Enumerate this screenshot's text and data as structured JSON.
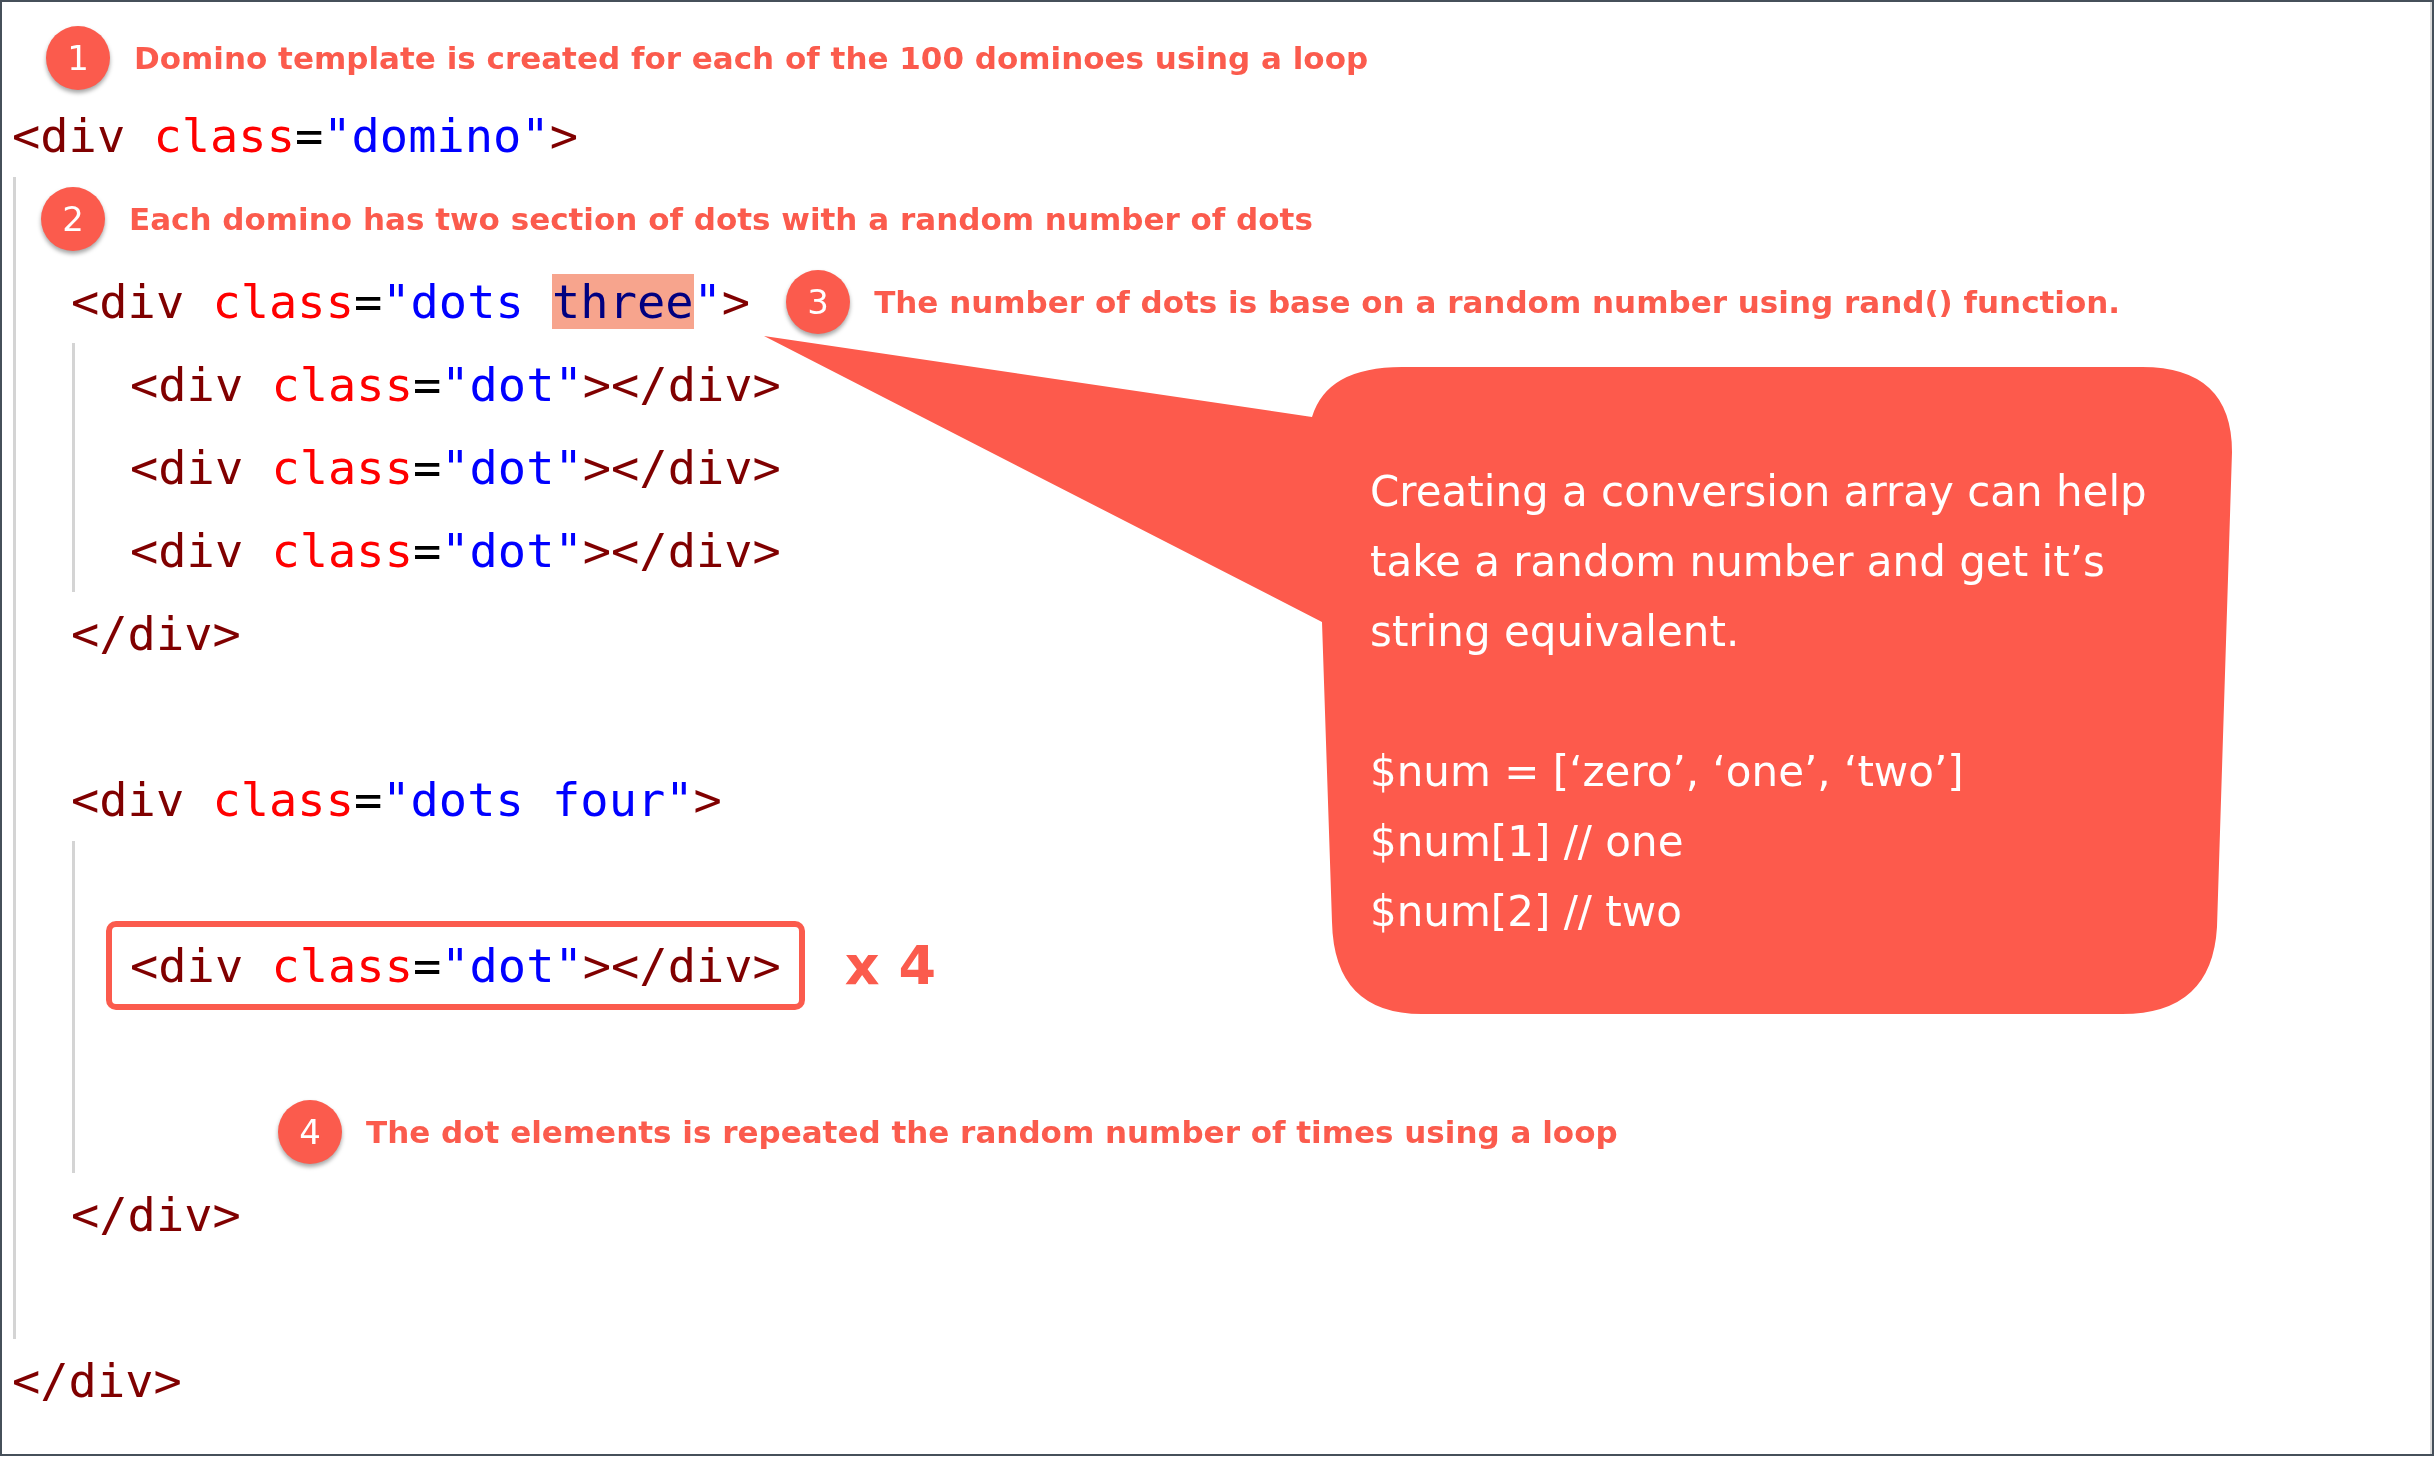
{
  "top_annotation": {
    "number": "1",
    "text": "Domino template is created for each of the 100 dominoes using a loop"
  },
  "code": {
    "kind": "element",
    "open": [
      {
        "kind": "tag",
        "t": "<div"
      },
      {
        "kind": "attr",
        "t": " class"
      },
      {
        "kind": "op",
        "t": "="
      },
      {
        "kind": "str",
        "t": "\"domino\""
      },
      {
        "kind": "tag",
        "t": ">"
      }
    ],
    "children": [
      {
        "kind": "annotation",
        "number": "2",
        "text": "Each domino has two section of dots with a random number of dots"
      },
      {
        "kind": "element",
        "open": [
          {
            "kind": "tag",
            "t": "<div"
          },
          {
            "kind": "attr",
            "t": " class"
          },
          {
            "kind": "op",
            "t": "="
          },
          {
            "kind": "str",
            "t": "\"dots "
          },
          {
            "kind": "hl",
            "t": "three"
          },
          {
            "kind": "str",
            "t": "\""
          },
          {
            "kind": "tag",
            "t": ">"
          }
        ],
        "annotation": {
          "number": "3",
          "text": "The number of dots is base on a random number using rand() function."
        },
        "children": [
          {
            "kind": "line",
            "tokens": [
              {
                "kind": "tag",
                "t": "<div"
              },
              {
                "kind": "attr",
                "t": " class"
              },
              {
                "kind": "op",
                "t": "="
              },
              {
                "kind": "str",
                "t": "\"dot\""
              },
              {
                "kind": "tag",
                "t": "></div>"
              }
            ]
          },
          {
            "kind": "line",
            "tokens": [
              {
                "kind": "tag",
                "t": "<div"
              },
              {
                "kind": "attr",
                "t": " class"
              },
              {
                "kind": "op",
                "t": "="
              },
              {
                "kind": "str",
                "t": "\"dot\""
              },
              {
                "kind": "tag",
                "t": "></div>"
              }
            ]
          },
          {
            "kind": "line",
            "tokens": [
              {
                "kind": "tag",
                "t": "<div"
              },
              {
                "kind": "attr",
                "t": " class"
              },
              {
                "kind": "op",
                "t": "="
              },
              {
                "kind": "str",
                "t": "\"dot\""
              },
              {
                "kind": "tag",
                "t": "></div>"
              }
            ]
          }
        ],
        "close": [
          {
            "kind": "tag",
            "t": "</div>"
          }
        ]
      },
      {
        "kind": "blank"
      },
      {
        "kind": "element",
        "open": [
          {
            "kind": "tag",
            "t": "<div"
          },
          {
            "kind": "attr",
            "t": " class"
          },
          {
            "kind": "op",
            "t": "="
          },
          {
            "kind": "str",
            "t": "\"dots four\""
          },
          {
            "kind": "tag",
            "t": ">"
          }
        ],
        "children": [
          {
            "kind": "blank"
          },
          {
            "kind": "boxed_line",
            "repeat": "x 4",
            "tokens": [
              {
                "kind": "tag",
                "t": "<div"
              },
              {
                "kind": "attr",
                "t": " class"
              },
              {
                "kind": "op",
                "t": "="
              },
              {
                "kind": "str",
                "t": "\"dot\""
              },
              {
                "kind": "tag",
                "t": "></div>"
              }
            ]
          },
          {
            "kind": "blank"
          },
          {
            "kind": "annotation",
            "number": "4",
            "text": "The dot elements is repeated the random number of times using a loop"
          }
        ],
        "close": [
          {
            "kind": "tag",
            "t": "</div>"
          }
        ]
      },
      {
        "kind": "blank"
      }
    ],
    "close": [
      {
        "kind": "tag",
        "t": "</div>"
      }
    ]
  },
  "callout": {
    "paragraph_lines": [
      "Creating a conversion array can help",
      "take a random number and get it’s",
      "string equivalent."
    ],
    "code_lines": [
      "$num = [‘zero’, ‘one’, ‘two’]",
      "$num[1] // one",
      "$num[2] // two"
    ]
  }
}
